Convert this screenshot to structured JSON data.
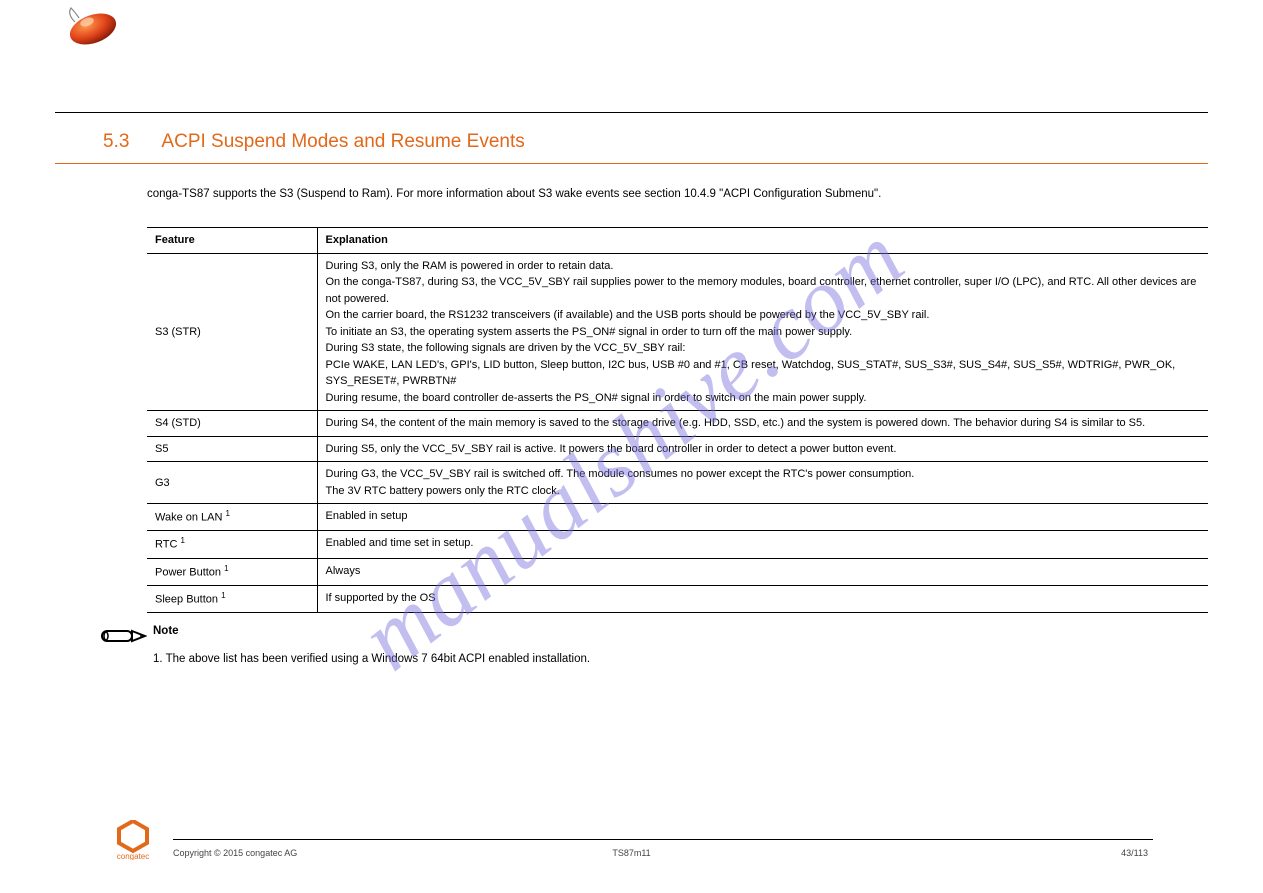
{
  "tip": "(tip)",
  "section": {
    "number": "5.3",
    "title": "ACPI Suspend Modes and Resume Events"
  },
  "intro": "conga-TS87 supports the S3 (Suspend to Ram). For more information about S3 wake events see section 10.4.9 \"ACPI Configuration Submenu\".",
  "table": {
    "headers": [
      "Feature",
      "Explanation"
    ],
    "rows": [
      [
        "S3 (STR)",
        "During S3, only the RAM is powered in order to retain data.\nOn the conga-TS87, during S3, the VCC_5V_SBY rail supplies power to the memory modules, board controller, ethernet controller, super I/O (LPC), and RTC. All other devices are not powered.\nOn the carrier board, the RS1232 transceivers (if available) and the USB ports should be powered by the VCC_5V_SBY rail.\nTo initiate an S3, the operating system asserts the PS_ON# signal in order to turn off the main power supply.\nDuring S3 state, the following signals are driven by the VCC_5V_SBY rail:\nPCIe WAKE, LAN LED's, GPI's, LID button, Sleep button, I2C bus, USB #0 and #1, CB reset, Watchdog, SUS_STAT#, SUS_S3#, SUS_S4#, SUS_S5#, WDTRIG#, PWR_OK, SYS_RESET#, PWRBTN#\nDuring resume, the board controller de-asserts the PS_ON# signal in order to switch on the main power supply."
      ],
      [
        "S4 (STD)",
        "During S4, the content of the main memory is saved to the storage drive (e.g. HDD, SSD, etc.) and the system is powered down. The behavior during S4 is similar to S5."
      ],
      [
        "S5",
        "During S5, only the VCC_5V_SBY rail is active. It powers the board controller in order to detect a power button event."
      ],
      [
        "G3",
        "During G3, the VCC_5V_SBY rail is switched off. The module consumes no power except the RTC's power consumption.\nThe 3V RTC battery powers only the RTC clock."
      ],
      [
        "Wake on LAN ¹",
        "Enabled in setup"
      ],
      [
        "RTC ¹",
        "Enabled and time set in setup."
      ],
      [
        "Power Button ¹",
        "Always"
      ],
      [
        "Sleep Button ¹",
        "If supported by the OS"
      ]
    ]
  },
  "note": {
    "label": "Note",
    "items": "1. The above list has been verified using a Windows 7 64bit ACPI enabled installation."
  },
  "footer": {
    "left": "Copyright © 2015 congatec AG",
    "center": "TS87m11",
    "right": "43/113"
  },
  "watermark": "manualshive.com",
  "colors": {
    "brand": "#E2681A"
  }
}
